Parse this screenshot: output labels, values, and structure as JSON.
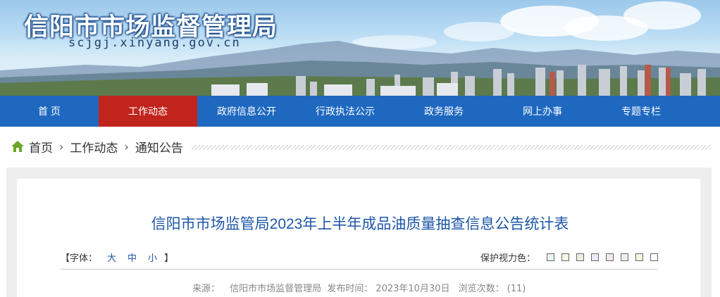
{
  "site": {
    "title": "信阳市市场监督管理局",
    "url": "scjgj.xinyang.gov.cn"
  },
  "nav": {
    "items": [
      {
        "label": "首 页",
        "active": false
      },
      {
        "label": "工作动态",
        "active": true
      },
      {
        "label": "政府信息公开",
        "active": false
      },
      {
        "label": "行政执法公示",
        "active": false
      },
      {
        "label": "政务服务",
        "active": false
      },
      {
        "label": "网上办事",
        "active": false
      },
      {
        "label": "专题专栏",
        "active": false
      }
    ]
  },
  "breadcrumb": {
    "home": "首页",
    "level1": "工作动态",
    "level2": "通知公告",
    "separator": "›"
  },
  "article": {
    "title": "信阳市市场监管局2023年上半年成品油质量抽查信息公告统计表",
    "font_size_label": "【字体：",
    "font_sizes": [
      "大",
      "中",
      "小"
    ],
    "font_size_close": "】",
    "eye_care_label": "保护视力色：",
    "eye_care_colors": [
      "#e8f4ec",
      "#f3f8e0",
      "#f1ece2",
      "#ecebf6",
      "#f4e8ec",
      "#efefef",
      "#fbf6e0",
      "#ffffff"
    ],
    "meta": {
      "source_label": "来源：",
      "source": "信阳市市场监督管理局",
      "date_label": "发布时间：",
      "date": "2023年10月30日",
      "views_label": "浏览次数：",
      "views": "(11)"
    }
  },
  "colors": {
    "nav_bg": "#1f68c0",
    "nav_active": "#c0241c",
    "title_blue": "#1d56a8",
    "home_icon": "#6aa52a"
  }
}
